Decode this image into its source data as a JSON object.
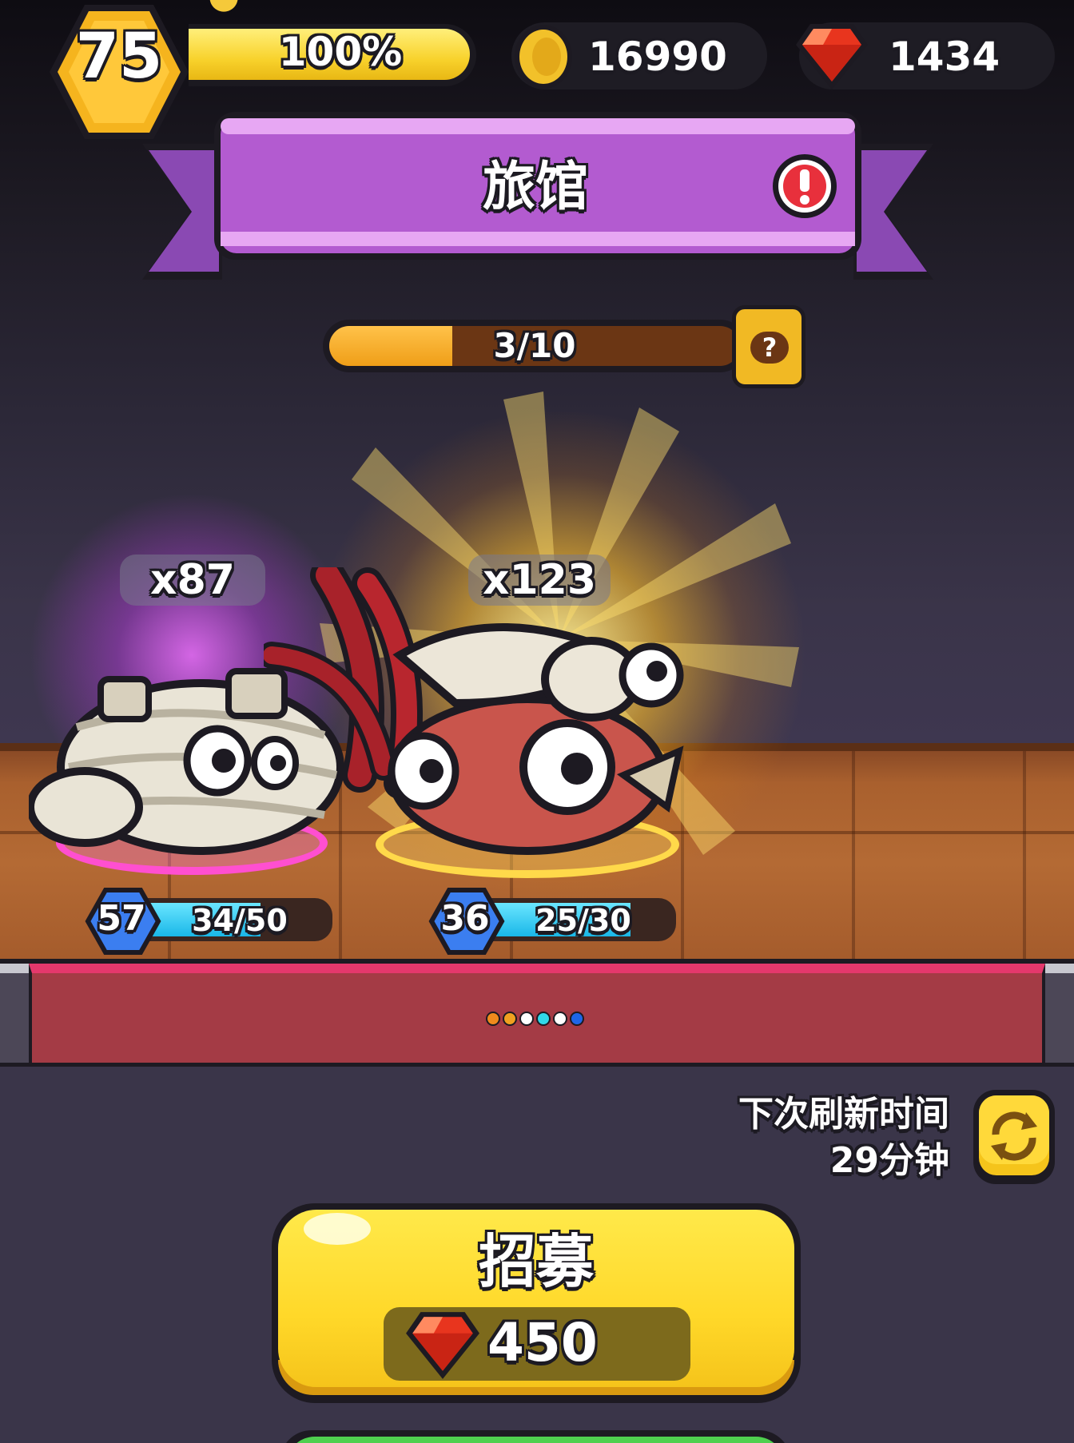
{
  "player": {
    "level": "75",
    "xp_percent_label": "100%",
    "xp_fill": 1.0
  },
  "currency": {
    "coins": "16990",
    "gems": "1434"
  },
  "header": {
    "title": "旅馆"
  },
  "progress": {
    "label": "3/10",
    "current": 3,
    "max": 10,
    "help_label": "?"
  },
  "creatures": [
    {
      "name": "mummy",
      "count": "x87",
      "level": "57",
      "hp_label": "34/50",
      "hp_fraction": 0.68,
      "rarity_color": "#ff4fd0"
    },
    {
      "name": "hermit-crab",
      "count": "x123",
      "level": "36",
      "hp_label": "25/30",
      "hp_fraction": 0.833,
      "rarity_color": "#ffd94a"
    }
  ],
  "page_dots": [
    "#f08a1c",
    "#f0a020",
    "#ffffff",
    "#30d8e8",
    "#ffffff",
    "#1e66e8"
  ],
  "refresh": {
    "label": "下次刷新时间",
    "time": "29分钟"
  },
  "recruit": {
    "label": "招募",
    "cost": "450"
  },
  "colors": {
    "banner_purple": "#b35bd0",
    "gold": "#ffd829",
    "gem_red": "#e8351e"
  }
}
